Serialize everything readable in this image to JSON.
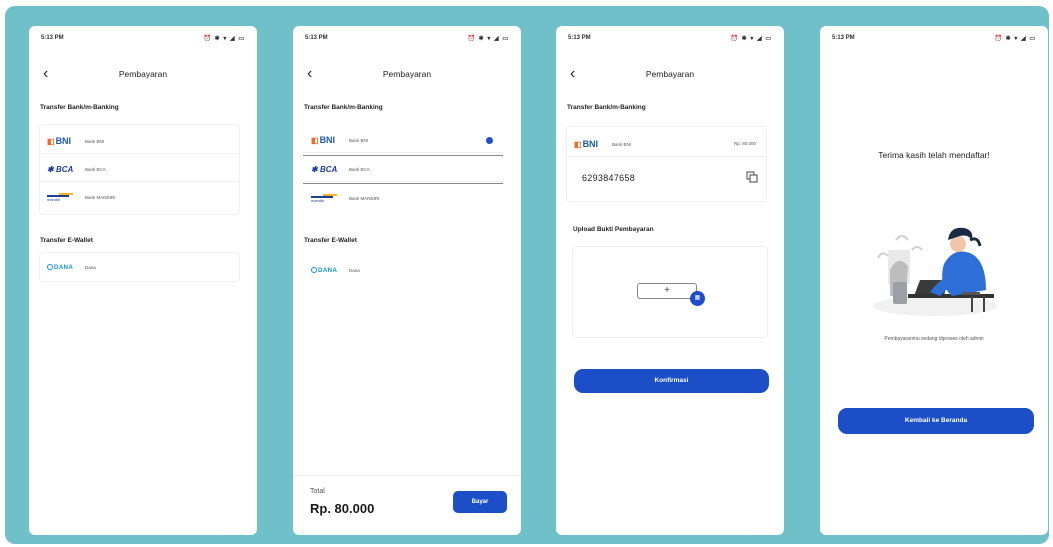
{
  "colors": {
    "frame": "#6fc0c9",
    "primary": "#1c4fc7",
    "bni_orange": "#f26a24",
    "bca_blue": "#1c3f94",
    "dana_blue": "#118ee9"
  },
  "status_bar": {
    "time": "5:13 PM",
    "icons": "⏰ ✱ ▾ ◢ ▭"
  },
  "screens": [
    {
      "title": "Pembayaran",
      "section_bank": "Transfer Bank/m-Banking",
      "banks": [
        {
          "logo": "BNI",
          "name": "Bank BNI"
        },
        {
          "logo": "BCA",
          "name": "Bank BCA"
        },
        {
          "logo": "mandiri",
          "name": "Bank MANDIRI"
        }
      ],
      "section_wallet": "Transfer E-Wallet",
      "wallets": [
        {
          "logo": "DANA",
          "name": "Dana"
        }
      ]
    },
    {
      "title": "Pembayaran",
      "section_bank": "Transfer Bank/m-Banking",
      "banks": [
        {
          "logo": "BNI",
          "name": "Bank BNI",
          "selected": true
        },
        {
          "logo": "BCA",
          "name": "Bank BCA"
        },
        {
          "logo": "mandiri",
          "name": "Bank MANDIRI"
        }
      ],
      "section_wallet": "Transfer E-Wallet",
      "wallets": [
        {
          "logo": "DANA",
          "name": "Dana"
        }
      ],
      "footer": {
        "total_label": "Total",
        "total_value": "Rp. 80.000",
        "pay_label": "Bayar"
      }
    },
    {
      "title": "Pembayaran",
      "section_bank": "Transfer Bank/m-Banking",
      "bank": {
        "logo": "BNI",
        "name": "Bank BNI",
        "amount": "Rp. 80.000"
      },
      "account_number": "6293847658",
      "upload_label": "Upload Bukti Pembayaran",
      "upload_plus": "+",
      "confirm_label": "Konfirmasi"
    },
    {
      "thanks_title": "Terima kasih telah mendaftar!",
      "pending_text": "Pembayaranmu sedang diproses oleh admin",
      "home_label": "Kembali ke Beranda"
    }
  ]
}
